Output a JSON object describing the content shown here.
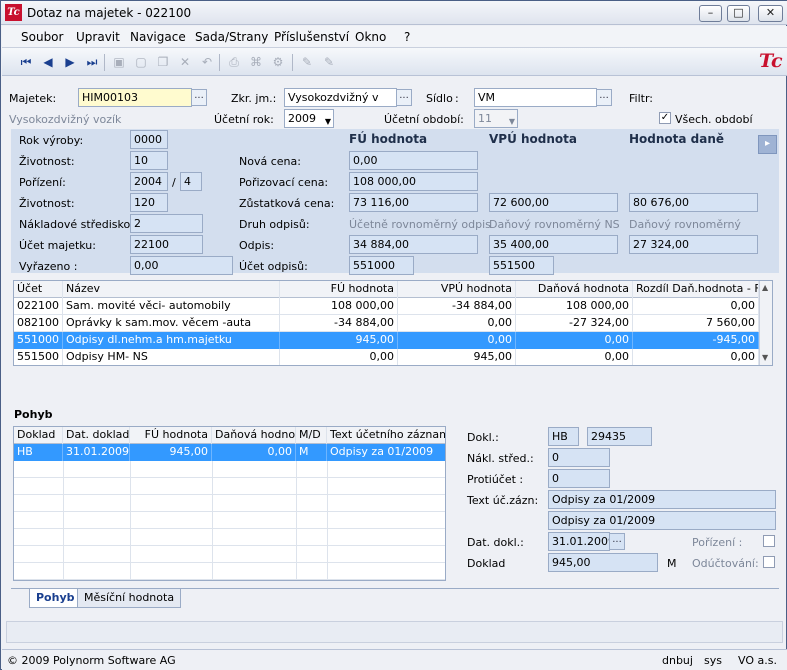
{
  "window": {
    "title": "Dotaz na majetek - 022100",
    "min": "–",
    "max": "□",
    "close": "✕"
  },
  "menu": [
    "Soubor",
    "Upravit",
    "Navigace",
    "Sada/Strany",
    "Příslušenství",
    "Okno",
    "?"
  ],
  "header": {
    "majetek_label": "Majetek:",
    "majetek_value": "HIM00103",
    "zkr_label": "Zkr. jm.:",
    "zkr_value": "Vysokozdvižný v",
    "sidlo_label": "Sídlo",
    "sidlo_colon": ":",
    "sidlo_value": "VM",
    "filtr_label": "Filtr:",
    "name_text": "Vysokozdvižný vozík",
    "ucetni_rok_label": "Účetní rok:",
    "ucetni_rok_value": "2009",
    "ucetni_obdobi_label": "Účetní období:",
    "ucetni_obdobi_value": "11",
    "vsech_obdobi_label": "Všech. období",
    "vsech_obdobi_checked": "✓"
  },
  "details": {
    "rok_vyroby_label": "Rok výroby:",
    "rok_vyroby": "0000",
    "zivotnost_label": "Životnost:",
    "zivotnost": "10",
    "porizeni_label": "Pořízení:",
    "porizeni_rok": "2004",
    "porizeni_sep": "/",
    "porizeni_mes": "4",
    "zivotnost2_label": "Životnost:",
    "zivotnost2": "120",
    "naklad_label": "Nákladové středisko:",
    "naklad": "2",
    "ucet_majetku_label": "Účet majetku:",
    "ucet_majetku": "22100",
    "vyrazeno_label": "Vyřazeno  :",
    "vyrazeno": "0,00",
    "col_fu": "FÚ hodnota",
    "col_vpu": "VPÚ hodnota",
    "col_dan": "Hodnota daně",
    "nova_cena_label": "Nová cena:",
    "nova_cena_fu": "0,00",
    "poriz_cena_label": "Pořizovací cena:",
    "poriz_cena_fu": "108 000,00",
    "zustatkova_label": "Zůstatková cena:",
    "zustatkova_fu": "73 116,00",
    "zustatkova_vpu": "72 600,00",
    "zustatkova_dan": "80 676,00",
    "druh_label": "Druh odpisů:",
    "druh_fu": "Účetně rovnoměrný odpis",
    "druh_vpu": "Daňový rovnoměrný NS",
    "druh_dan": "Daňový rovnoměrný",
    "odpis_label": "Odpis:",
    "odpis_fu": "34 884,00",
    "odpis_vpu": "35 400,00",
    "odpis_dan": "27 324,00",
    "ucet_odpisu_label": "Účet odpisů:",
    "ucet_odpisu_fu": "551000",
    "ucet_odpisu_vpu": "551500"
  },
  "accounts": {
    "columns": [
      "Účet",
      "Název",
      "FÚ hodnota",
      "VPÚ hodnota",
      "Daňová hodnota",
      "Rozdíl Daň.hodnota - FÚ"
    ],
    "rows": [
      [
        "022100",
        "Sam. movité věci- automobily",
        "108 000,00",
        "-34 884,00",
        "108 000,00",
        "0,00"
      ],
      [
        "082100",
        "Oprávky k sam.mov. věcem -auta",
        "-34 884,00",
        "0,00",
        "-27 324,00",
        "7 560,00"
      ],
      [
        "551000",
        "Odpisy dl.nehm.a hm.majetku",
        "945,00",
        "0,00",
        "0,00",
        "-945,00"
      ],
      [
        "551500",
        "Odpisy HM- NS",
        "0,00",
        "945,00",
        "0,00",
        "0,00"
      ]
    ]
  },
  "pohyb": {
    "title": "Pohyb",
    "columns": [
      "Doklad",
      "Dat. dokladu",
      "FÚ hodnota",
      "Daňová hodnota",
      "M/D",
      "Text účetního záznamu"
    ],
    "rows": [
      [
        "HB",
        "31.01.2009",
        "945,00",
        "0,00",
        "M",
        "Odpisy za 01/2009"
      ]
    ]
  },
  "pohyb_detail": {
    "dokl_label": "Dokl.:",
    "dokl_type": "HB",
    "dokl_num": "29435",
    "nakl_label": "Nákl. střed.:",
    "nakl": "0",
    "protiucet_label": "Protiúčet :",
    "protiucet": "0",
    "text_label": "Text úč.zázn:",
    "text1": "Odpisy za 01/2009",
    "text2": "Odpisy za 01/2009",
    "dat_label": "Dat. dokl.:",
    "dat": "31.01.2009",
    "doklad_label": "Doklad",
    "doklad": "945,00",
    "doklad_md": "M",
    "porizeni_label": "Pořízení   :",
    "oductovani_label": "Odúčtování:"
  },
  "tabs": [
    "Pohyb",
    "Měsíční hodnota"
  ],
  "status": {
    "copyright": "© 2009 Polynorm Software AG",
    "mode": "dnbuj",
    "user": "sys",
    "company": "VO a.s."
  }
}
